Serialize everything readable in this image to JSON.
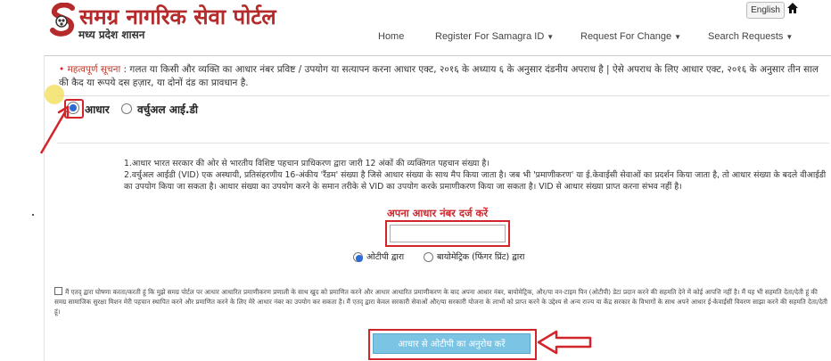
{
  "header": {
    "logo_title": "समग्र नागरिक सेवा पोर्टल",
    "logo_sub": "मध्य प्रदेश शासन",
    "language_button": "English",
    "nav": {
      "home": "Home",
      "register": "Register For Samagra ID",
      "request_change": "Request For Change",
      "search_requests": "Search Requests"
    }
  },
  "notice": {
    "label": "महत्वपूर्ण सूचना",
    "text": " : गलत या किसी और व्यक्ति का आधार नंबर प्रविष्ट / उपयोग या सत्यापन करना आधार एक्ट, २०१६ के अध्याय ६ के अनुसार दंडनीय अपराध है | ऐसे अपराध के लिए आधार एक्ट, २०१६ के अनुसार तीन साल की कैद या रूपये दस हज़ार, या दोनों दंड का प्रावधान है."
  },
  "id_type": {
    "aadhaar_label": "आधार",
    "vid_label": "वर्चुअल आई.डी",
    "selected": "आधार"
  },
  "info": {
    "line1": "1.आधार भारत सरकार की ओर से भारतीय विशिष्ट पहचान प्राधिकरण द्वारा जारी 12 अंकों की व्यक्तिगत पहचान संख्या है।",
    "line2": "2.वर्चुअल आईडी (VID) एक अस्थायी, प्रतिसंहरणीय 16-अंकीय 'रैंडम' संख्या है जिसे आधार संख्या के साथ मैप किया जाता है। जब भी 'प्रमाणीकरण' या ई.केवाईसी सेवाओं का प्रदर्शन किया जाता है, तो आधार संख्या के बदले वीआईडी का उपयोग किया जा सकता है। आधार संख्या का उपयोग करने के समान तरीके से VID का उपयोग करके प्रमाणीकरण किया जा सकता है। VID से आधार संख्या प्राप्त करना संभव नहीं है।"
  },
  "aadhaar_entry": {
    "heading": "अपना आधार नंबर दर्ज करें",
    "value": "",
    "placeholder": ""
  },
  "auth_method": {
    "otp_label": "ओटीपी द्वारा",
    "biometric_label": "बायोमेट्रिक (फिंगर प्रिंट) द्वारा",
    "selected": "ओटीपी द्वारा"
  },
  "consent": {
    "text": "मैं एतद् द्वारा घोषणा करता/करती हूं कि मुझे समग्र पोर्टल पर आधार आधारित प्रमाणीकरण प्रणाली के साथ खुद को प्रमाणित करने और आधार आधारित प्रमाणीकरण के बाद अपना आधार नंबर, बायोमेट्रिक, और/या वन-टाइम पिन (ओटीपी) डेटा प्रदान करने की सहमति देने में कोई आपत्ति नहीं है। मैं यह भी सहमति देता/देती हूं की समग्र सामाजिक सुरक्षा मिशन मेरी पहचान स्थापित करने और प्रमाणित करने के लिए मेरे आधार नंबर का उपयोग कर सकता है। मैं एतद् द्वारा केवल सरकारी सेवाओं और/या सरकारी योजना के लाभों को प्राप्त करने के उद्देश्य से अन्य राज्य या केंद्र सरकार के विभागों के साथ अपने आधार ई-केवाईसी विवरण साझा करने की सहमति देता/देती हूं।"
  },
  "submit": {
    "otp_button": "आधार से ओटीपी का अनुरोध करें"
  },
  "colors": {
    "brand_red": "#b52a2a",
    "highlight_red": "#d3242a",
    "button_blue": "#7cc4e3"
  }
}
